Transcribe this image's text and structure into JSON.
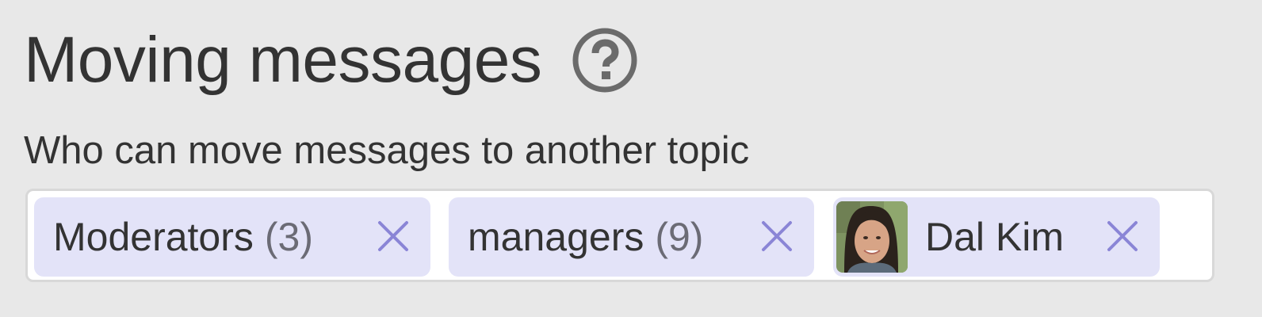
{
  "setting": {
    "title": "Moving messages",
    "help_icon": "question-circle-icon",
    "label": "Who can move messages to another topic"
  },
  "pills": [
    {
      "name": "Moderators",
      "count": "(3)",
      "type": "group",
      "remove_icon": "close-icon"
    },
    {
      "name": "managers",
      "count": "(9)",
      "type": "group",
      "remove_icon": "close-icon"
    },
    {
      "name": "Dal Kim",
      "type": "user",
      "avatar": "user-avatar",
      "remove_icon": "close-icon"
    }
  ],
  "colors": {
    "background": "#e8e8e8",
    "pill_background": "#e3e3f8",
    "remove_icon": "#8a85d6",
    "text": "#333333",
    "count_text": "#6b6b75"
  }
}
